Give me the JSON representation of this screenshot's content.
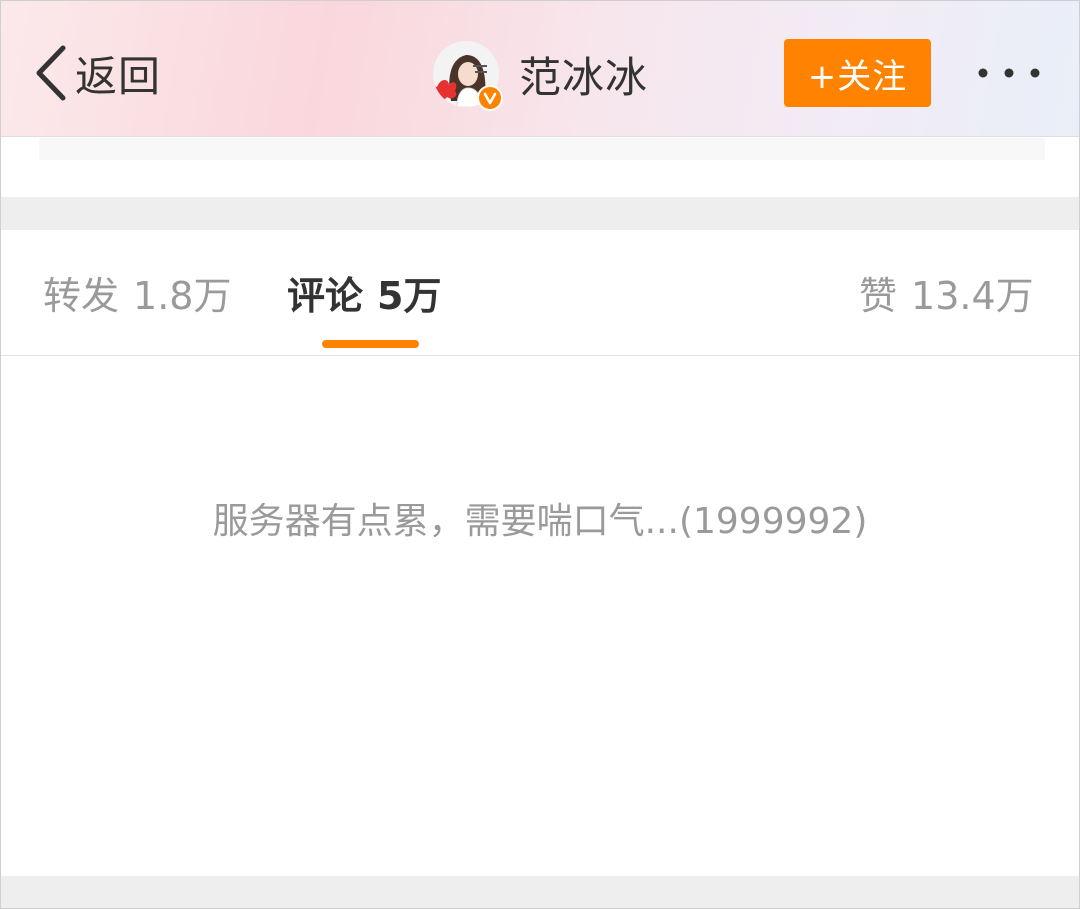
{
  "header": {
    "back_label": "返回",
    "back_icon": "chevron-left-icon",
    "user_name": "范冰冰",
    "avatar_icon": "avatar-illustration",
    "verified_icon": "verified-v-badge-icon",
    "follow_label": "+关注",
    "more_icon": "more-dots-icon",
    "colors": {
      "accent": "#ff8200",
      "verified": "#ff8200"
    }
  },
  "tabs": [
    {
      "label": "转发",
      "count": "1.8万",
      "active": false
    },
    {
      "label": "评论",
      "count": "5万",
      "active": true
    },
    {
      "label": "赞",
      "count": "13.4万",
      "active": false
    }
  ],
  "content": {
    "message": "服务器有点累，需要喘口气...(1999992)"
  }
}
